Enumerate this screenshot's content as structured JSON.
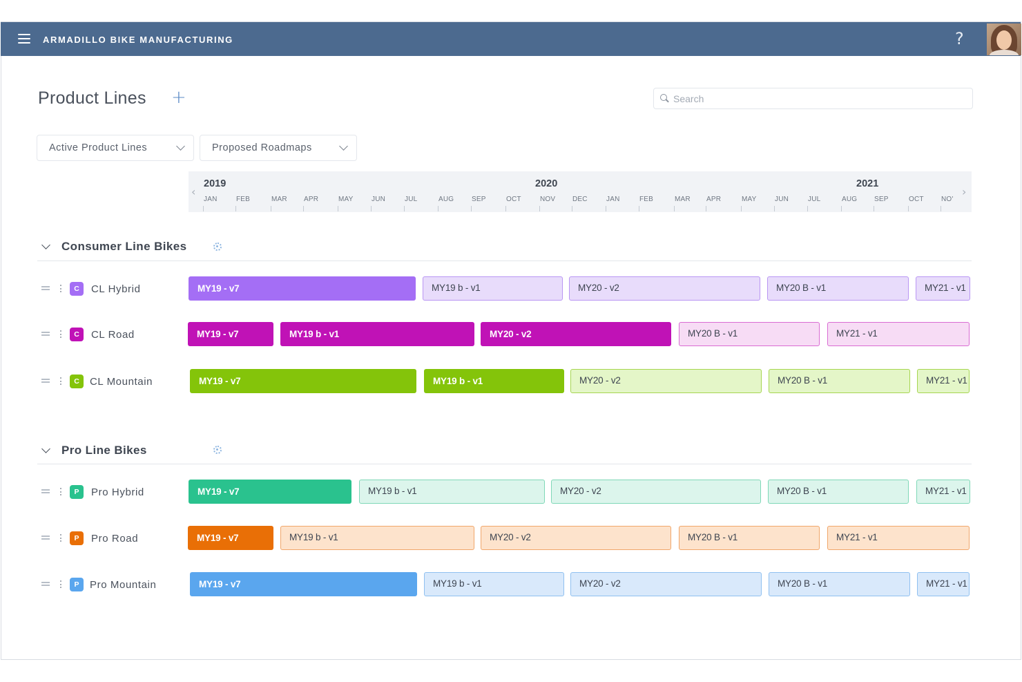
{
  "app": {
    "title": "ARMADILLO BIKE MANUFACTURING",
    "help_glyph": "?",
    "menu_icon": "hamburger-icon"
  },
  "page": {
    "title": "Product Lines",
    "add_glyph": "+"
  },
  "search": {
    "placeholder": "Search"
  },
  "filters": [
    {
      "label": "Active Product Lines"
    },
    {
      "label": "Proposed Roadmaps"
    }
  ],
  "timeline": {
    "prev_glyph": "‹",
    "next_glyph": "›",
    "years": [
      "2019",
      "2020",
      "2021"
    ],
    "months": [
      "JAN",
      "FEB",
      "MAR",
      "APR",
      "MAY",
      "JUN",
      "JUL",
      "AUG",
      "SEP",
      "OCT",
      "NOV",
      "DEC",
      "JAN",
      "FEB",
      "MAR",
      "APR",
      "MAY",
      "JUN",
      "JUL",
      "AUG",
      "SEP",
      "OCT",
      "NO'"
    ]
  },
  "groups": [
    {
      "title": "Consumer Line Bikes",
      "rows": [
        {
          "name": "CL Hybrid",
          "badge": "C",
          "color": "#a46ef5",
          "light": "#e8dcfb",
          "border": "#b996f3",
          "light_text": "#3d4450",
          "bars": [
            "MY19 - v7",
            "MY19 b - v1",
            "MY20 - v2",
            "MY20 B - v1",
            "MY21 - v1"
          ]
        },
        {
          "name": "CL Road",
          "badge": "C",
          "color": "#c012b6",
          "light": "#f7dcf5",
          "border": "#d96bd3",
          "light_text": "#3d4450",
          "bars": [
            "MY19 - v7",
            "MY19 b - v1",
            "MY20 - v2",
            "MY20 B - v1",
            "MY21 - v1"
          ]
        },
        {
          "name": "CL Mountain",
          "badge": "C",
          "color": "#84c40a",
          "light": "#e4f6c8",
          "border": "#a6d650",
          "light_text": "#3d4450",
          "bars": [
            "MY19 - v7",
            "MY19 b - v1",
            "MY20 - v2",
            "MY20 B - v1",
            "MY21 - v1"
          ]
        }
      ]
    },
    {
      "title": "Pro Line Bikes",
      "rows": [
        {
          "name": "Pro Hybrid",
          "badge": "P",
          "color": "#2ac28e",
          "light": "#dcf5ec",
          "border": "#7fd8b7",
          "light_text": "#3d4450",
          "bars": [
            "MY19 - v7",
            "MY19 b - v1",
            "MY20 - v2",
            "MY20 B - v1",
            "MY21 - v1"
          ]
        },
        {
          "name": "Pro Road",
          "badge": "P",
          "color": "#e96f06",
          "light": "#fde3cc",
          "border": "#f0a66a",
          "light_text": "#3d4450",
          "bars": [
            "MY19 - v7",
            "MY19 b - v1",
            "MY20 - v2",
            "MY20 B - v1",
            "MY21 - v1"
          ]
        },
        {
          "name": "Pro Mountain",
          "badge": "P",
          "color": "#5aa6ee",
          "light": "#d9e9fb",
          "border": "#8fc0f0",
          "light_text": "#3d4450",
          "bars": [
            "MY19 - v7",
            "MY19 b - v1",
            "MY20 - v2",
            "MY20 B - v1",
            "MY21 - v1"
          ]
        }
      ]
    }
  ]
}
